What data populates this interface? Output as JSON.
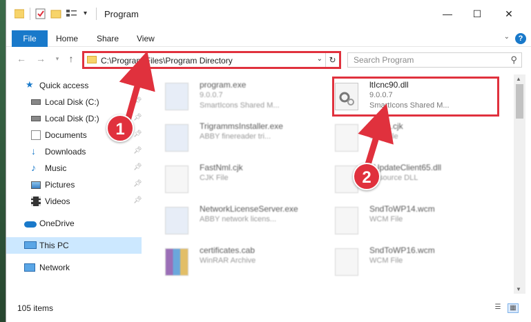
{
  "window": {
    "title": "Program",
    "minimize": "—",
    "maximize": "☐",
    "close": "✕"
  },
  "ribbon": {
    "file": "File",
    "home": "Home",
    "share": "Share",
    "view": "View",
    "help": "?"
  },
  "nav": {
    "address": "C:\\Program Files\\Program Directory",
    "search_placeholder": "Search Program"
  },
  "sidebar": {
    "items": [
      {
        "label": "Quick access",
        "icon": "star-icon"
      },
      {
        "label": "Local Disk (C:)",
        "icon": "drive-icon",
        "pinned": true
      },
      {
        "label": "Local Disk (D:)",
        "icon": "drive-icon",
        "pinned": true
      },
      {
        "label": "Documents",
        "icon": "documents-icon",
        "pinned": true
      },
      {
        "label": "Downloads",
        "icon": "download-icon",
        "pinned": true
      },
      {
        "label": "Music",
        "icon": "music-icon",
        "pinned": true
      },
      {
        "label": "Pictures",
        "icon": "pictures-icon",
        "pinned": true
      },
      {
        "label": "Videos",
        "icon": "videos-icon",
        "pinned": true
      },
      {
        "label": "OneDrive",
        "icon": "cloud-icon"
      },
      {
        "label": "This PC",
        "icon": "pc-icon",
        "selected": true
      },
      {
        "label": "Network",
        "icon": "network-icon"
      }
    ]
  },
  "files": [
    {
      "name": "program.exe",
      "line1": "9.0.0.7",
      "line2": "SmartIcons Shared M...",
      "icon": "exe-icon"
    },
    {
      "name": "ltIcnc90.dll",
      "line1": "9.0.0.7",
      "line2": "SmartIcons Shared M...",
      "icon": "dll-gear-icon",
      "highlighted": true
    },
    {
      "name": "TrigrammsInstaller.exe",
      "line1": "ABBY finereader tri...",
      "line2": "",
      "icon": "exe-icon"
    },
    {
      "name": "ltwcm.cjk",
      "line1": "CJK File",
      "line2": "",
      "icon": "file-icon"
    },
    {
      "name": "FastNml.cjk",
      "line1": "CJK File",
      "line2": "",
      "icon": "file-icon"
    },
    {
      "name": "ltUpdateClient65.dll",
      "line1": "Resource DLL",
      "line2": "",
      "icon": "dll-gear-icon"
    },
    {
      "name": "NetworkLicenseServer.exe",
      "line1": "ABBY network licens...",
      "line2": "",
      "icon": "exe-icon"
    },
    {
      "name": "SndToWP14.wcm",
      "line1": "WCM File",
      "line2": "",
      "icon": "file-icon"
    },
    {
      "name": "certificates.cab",
      "line1": "WinRAR Archive",
      "line2": "",
      "icon": "winrar-icon"
    },
    {
      "name": "SndToWP16.wcm",
      "line1": "WCM File",
      "line2": "",
      "icon": "file-icon"
    }
  ],
  "status": {
    "count": "105 items"
  },
  "annotations": {
    "step1": "1",
    "step2": "2",
    "color": "#e0313d"
  }
}
